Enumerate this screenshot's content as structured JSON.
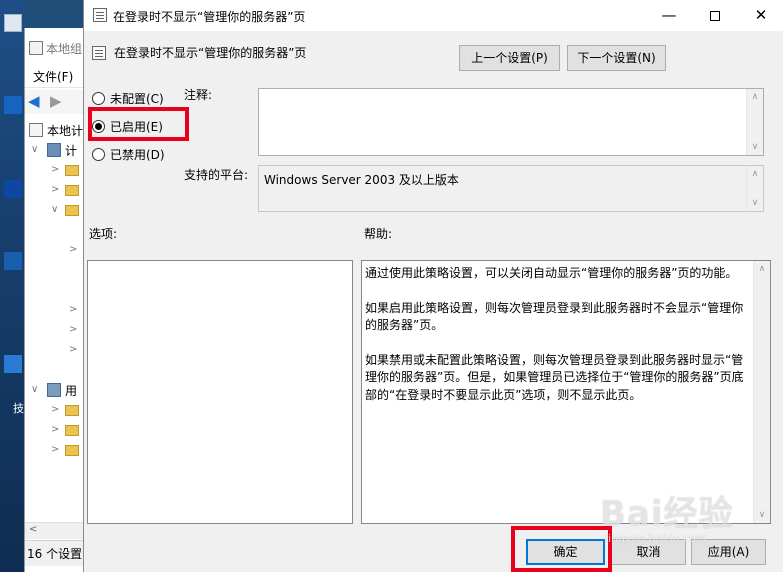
{
  "background_window": {
    "title": "本地组",
    "menu": "文件(F)",
    "tree": {
      "root_label": "本地计",
      "computer_label": "计",
      "user_label": "用"
    },
    "status": "16 个设置",
    "desktop_label": "技"
  },
  "dialog": {
    "window_title": "在登录时不显示“管理你的服务器”页",
    "header_title": "在登录时不显示“管理你的服务器”页",
    "prev_setting_label": "上一个设置(P)",
    "next_setting_label": "下一个设置(N)",
    "radios": [
      {
        "label": "未配置(C)",
        "checked": false
      },
      {
        "label": "已启用(E)",
        "checked": true
      },
      {
        "label": "已禁用(D)",
        "checked": false
      }
    ],
    "comment_label": "注释:",
    "comment_value": "",
    "supported_label": "支持的平台:",
    "supported_value": "Windows Server 2003 及以上版本",
    "options_label": "选项:",
    "help_label": "帮助:",
    "help_paragraphs": [
      "通过使用此策略设置，可以关闭自动显示“管理你的服务器”页的功能。",
      "如果启用此策略设置，则每次管理员登录到此服务器时不会显示“管理你的服务器”页。",
      "如果禁用或未配置此策略设置，则每次管理员登录到此服务器时显示“管理你的服务器”页。但是，如果管理员已选择位于“管理你的服务器”页底部的“在登录时不要显示此页”选项，则不显示此页。"
    ],
    "ok_label": "确定",
    "cancel_label": "取消",
    "apply_label": "应用(A)",
    "highlight_color": "#e8001c",
    "accent_color": "#0078d7"
  },
  "watermark": {
    "text": "Bai经验",
    "sub": "jingyan.baidu.com"
  },
  "icons": {
    "window_icon": "policy-doc-icon",
    "minimize": "minimize-icon",
    "maximize": "maximize-icon",
    "close": "close-icon"
  }
}
